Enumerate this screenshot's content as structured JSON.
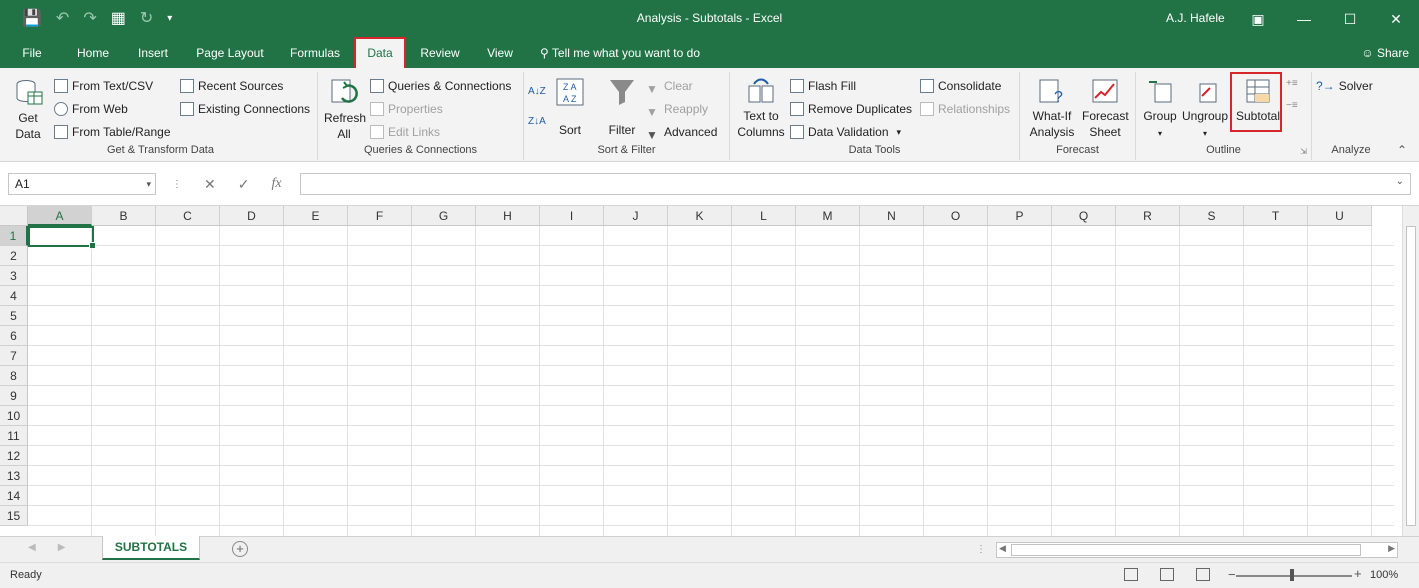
{
  "window": {
    "title": "Analysis - Subtotals  -  Excel",
    "user": "A.J. Hafele",
    "controls": [
      "restore-ribbon",
      "minimize",
      "maximize",
      "close"
    ]
  },
  "tabs": [
    {
      "label": "File"
    },
    {
      "label": "Home"
    },
    {
      "label": "Insert"
    },
    {
      "label": "Page Layout"
    },
    {
      "label": "Formulas"
    },
    {
      "label": "Data"
    },
    {
      "label": "Review"
    },
    {
      "label": "View"
    }
  ],
  "active_tab": "Data",
  "tell_me": "Tell me what you want to do",
  "share": "Share",
  "ribbon": {
    "get_transform": {
      "label": "Get & Transform Data",
      "get_data": "Get Data",
      "from_text": "From Text/CSV",
      "from_web": "From Web",
      "from_table": "From Table/Range",
      "recent_sources": "Recent Sources",
      "existing_connections": "Existing Connections"
    },
    "queries": {
      "label": "Queries & Connections",
      "refresh_all": "Refresh All",
      "queries_connections": "Queries & Connections",
      "properties": "Properties",
      "edit_links": "Edit Links"
    },
    "sort_filter": {
      "label": "Sort & Filter",
      "sort": "Sort",
      "filter": "Filter",
      "clear": "Clear",
      "reapply": "Reapply",
      "advanced": "Advanced"
    },
    "data_tools": {
      "label": "Data Tools",
      "text_to_columns": "Text to Columns",
      "flash_fill": "Flash Fill",
      "remove_duplicates": "Remove Duplicates",
      "data_validation": "Data Validation",
      "consolidate": "Consolidate",
      "relationships": "Relationships"
    },
    "forecast": {
      "label": "Forecast",
      "what_if": "What-If Analysis",
      "forecast_sheet": "Forecast Sheet"
    },
    "outline": {
      "label": "Outline",
      "group": "Group",
      "ungroup": "Ungroup",
      "subtotal": "Subtotal"
    },
    "analyze": {
      "label": "Analyze",
      "solver": "Solver"
    }
  },
  "formula_bar": {
    "name_box": "A1",
    "fx": "fx",
    "formula": ""
  },
  "sheet": {
    "columns": [
      "A",
      "B",
      "C",
      "D",
      "E",
      "F",
      "G",
      "H",
      "I",
      "J",
      "K",
      "L",
      "M",
      "N",
      "O",
      "P",
      "Q",
      "R",
      "S",
      "T",
      "U"
    ],
    "rows": [
      "1",
      "2",
      "3",
      "4",
      "5",
      "6",
      "7",
      "8",
      "9",
      "10",
      "11",
      "12",
      "13",
      "14",
      "15"
    ],
    "active_cell": "A1"
  },
  "sheet_tabs": [
    {
      "name": "SUBTOTALS",
      "active": true
    }
  ],
  "status": {
    "text": "Ready",
    "zoom": "100%"
  },
  "colors": {
    "brand": "#217346",
    "highlight": "#d7262b"
  }
}
